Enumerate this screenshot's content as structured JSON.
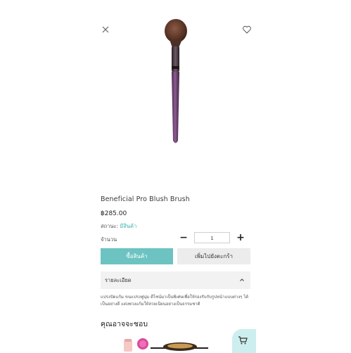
{
  "product": {
    "title": "Beneficial Pro Blush Brush",
    "price": "฿285.00",
    "status_label": "สถานะ:",
    "status_value": "มีสินค้า"
  },
  "quantity": {
    "label": "จำนวน",
    "value": "1",
    "minus": "−",
    "plus": "+"
  },
  "actions": {
    "buy_label": "ซื้อสินค้า",
    "add_to_cart_label": "เพิ่มไปยังตะกร้า"
  },
  "details": {
    "heading": "รายละเอียด",
    "text": "แปรงปัดแก้ม ขนแปรงฟูนุ่ม ดีไซน์มาเป็นพิเศษเพื่อให้รองรับกับรูปหน้าแบบต่างๆ ได้เป็นอย่างดี แต่งพวงแก้มให้สวยเนียนอย่างเป็นธรรมชาติ"
  },
  "suggestions": {
    "heading": "คุณอาจจะชอบ"
  },
  "icons": {
    "close": "close-icon",
    "wishlist": "heart-icon",
    "chevron": "chevron-up-icon",
    "cart": "cart-icon"
  },
  "colors": {
    "accent": "#6cc3c1",
    "status": "#3bb3ad",
    "fab": "#cdeeee"
  }
}
